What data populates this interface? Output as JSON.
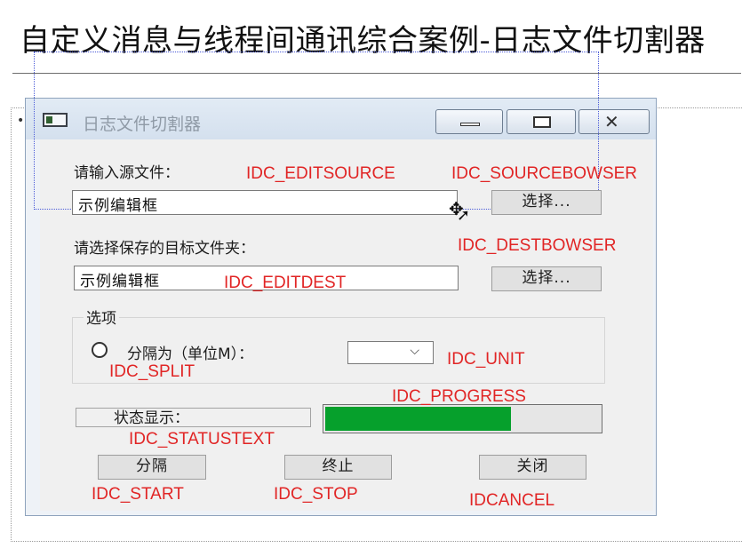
{
  "slide": {
    "title": "自定义消息与线程间通讯综合案例-日志文件切割器"
  },
  "window": {
    "title": "日志文件切割器",
    "buttons": {
      "minimize": "minimize",
      "maximize": "maximize",
      "close": "close"
    }
  },
  "form": {
    "source_label": "请输入源文件：",
    "source_value": "示例编辑框",
    "source_browse": "选择...",
    "dest_label": "请选择保存的目标文件夹：",
    "dest_value": "示例编辑框",
    "dest_browse": "选择...",
    "options_group": "选项",
    "split_label": "分隔为（单位M）：",
    "unit_value": "",
    "status_text": "状态显示：",
    "progress": 0.68,
    "start_label": "分隔",
    "stop_label": "终止",
    "close_label": "关闭"
  },
  "annotations": {
    "editsource": "IDC_EDITSOURCE",
    "sourcebowser": "IDC_SOURCEBOWSER",
    "destbowser": "IDC_DESTBOWSER",
    "editdest": "IDC_EDITDEST",
    "unit": "IDC_UNIT",
    "split": "IDC_SPLIT",
    "progress": "IDC_PROGRESS",
    "statustext": "IDC_STATUSTEXT",
    "start": "IDC_START",
    "stop": "IDC_STOP",
    "cancel": "IDCANCEL"
  },
  "colors": {
    "annotation": "#e12525",
    "progress_fill": "#06a02c"
  },
  "icons": {
    "app": "window-app-icon",
    "cursor": "move-cursor-icon",
    "combo": "chevron-down-icon"
  }
}
